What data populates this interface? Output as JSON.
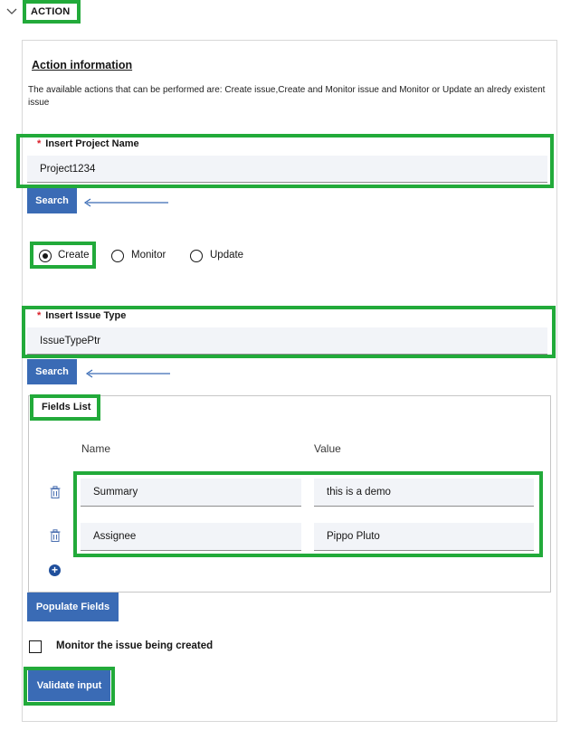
{
  "section": {
    "title": "ACTION",
    "toggle_icon": "chevron-down-icon"
  },
  "info": {
    "heading": "Action information",
    "description": "The available actions that can be performed are: Create issue,Create and Monitor issue and Monitor or Update an alredy existent issue"
  },
  "project": {
    "required_mark": "*",
    "label": "Insert Project Name",
    "value": "Project1234",
    "search_label": "Search"
  },
  "actions": {
    "options": [
      "Create",
      "Monitor",
      "Update"
    ],
    "selected": "Create"
  },
  "issue_type": {
    "required_mark": "*",
    "label": "Insert Issue Type",
    "value": "IssueTypePtr",
    "search_label": "Search"
  },
  "fields": {
    "title": "Fields List",
    "columns": [
      "Name",
      "Value"
    ],
    "rows": [
      {
        "name": "Summary",
        "value": "this is a demo"
      },
      {
        "name": "Assignee",
        "value": "Pippo Pluto"
      }
    ],
    "add_icon": "plus-circle-icon",
    "delete_icon": "trash-icon"
  },
  "populate_label": "Populate Fields",
  "monitor": {
    "label": "Monitor the issue being created",
    "checked": false
  },
  "validate_label": "Validate input",
  "highlight_color": "#22aa3a",
  "button_color": "#3a6bb5"
}
